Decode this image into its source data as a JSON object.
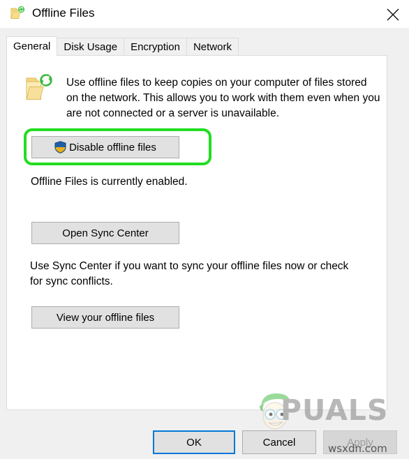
{
  "window": {
    "title": "Offline Files",
    "icon": "offline-files-folder-sync-icon",
    "close_label": "✕"
  },
  "tabs": [
    {
      "label": "General",
      "active": true
    },
    {
      "label": "Disk Usage",
      "active": false
    },
    {
      "label": "Encryption",
      "active": false
    },
    {
      "label": "Network",
      "active": false
    }
  ],
  "general": {
    "info_icon": "folder-sync-icon",
    "info_text": "Use offline files to keep copies on your computer of files stored on the network.  This allows you to work with them even when you are not connected or a server is unavailable.",
    "disable_button": {
      "label": "Disable offline files",
      "icon": "uac-shield-icon",
      "highlighted": true
    },
    "status_text": "Offline Files is currently enabled.",
    "sync_center_button": {
      "label": "Open Sync Center"
    },
    "sync_help_text": "Use Sync Center if you want to sync your offline files now or check for sync conflicts.",
    "view_offline_button": {
      "label": "View your offline files"
    }
  },
  "footer": {
    "ok_label": "OK",
    "cancel_label": "Cancel",
    "apply_label": "Apply",
    "apply_disabled": true
  },
  "watermarks": {
    "brand": "PUALS",
    "site": "wsxdn.com"
  },
  "colors": {
    "highlight_green": "#22dd22",
    "focus_blue": "#0078d7",
    "button_face": "#e1e1e1",
    "disabled_text": "#9d9d9d"
  }
}
